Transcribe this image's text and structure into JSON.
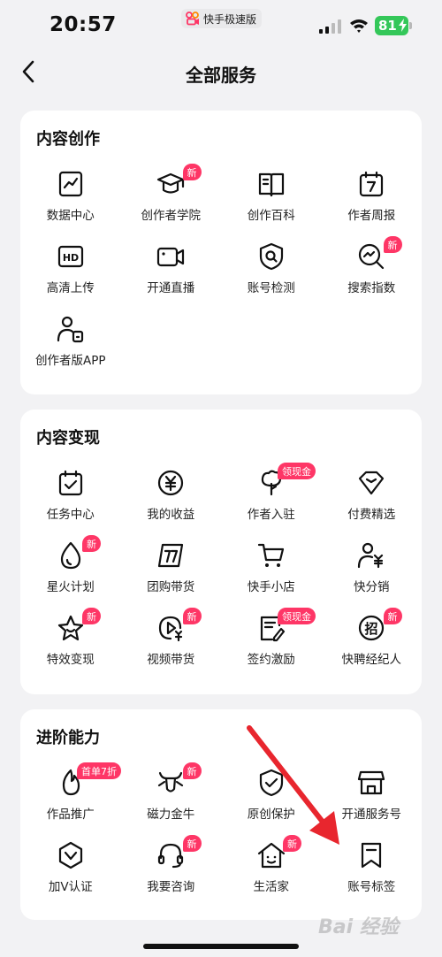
{
  "status_bar": {
    "time": "20:57",
    "app_label": "快手极速版",
    "battery": "81"
  },
  "nav": {
    "title": "全部服务"
  },
  "colors": {
    "accent": "#fe3666",
    "battery": "#34c759",
    "arrow": "#e8262e"
  },
  "sections": [
    {
      "title": "内容创作",
      "items": [
        {
          "label": "数据中心",
          "icon": "chart-icon",
          "badge": ""
        },
        {
          "label": "创作者学院",
          "icon": "graduation-cap-icon",
          "badge": "新"
        },
        {
          "label": "创作百科",
          "icon": "book-icon",
          "badge": ""
        },
        {
          "label": "作者周报",
          "icon": "calendar-7-icon",
          "badge": ""
        },
        {
          "label": "高清上传",
          "icon": "hd-icon",
          "badge": ""
        },
        {
          "label": "开通直播",
          "icon": "video-camera-icon",
          "badge": ""
        },
        {
          "label": "账号检测",
          "icon": "shield-search-icon",
          "badge": ""
        },
        {
          "label": "搜索指数",
          "icon": "search-trend-icon",
          "badge": "新"
        },
        {
          "label": "创作者版APP",
          "icon": "user-phone-icon",
          "badge": ""
        }
      ]
    },
    {
      "title": "内容变现",
      "items": [
        {
          "label": "任务中心",
          "icon": "calendar-check-icon",
          "badge": ""
        },
        {
          "label": "我的收益",
          "icon": "yen-circle-icon",
          "badge": ""
        },
        {
          "label": "作者入驻",
          "icon": "tree-icon",
          "badge": "领现金"
        },
        {
          "label": "付费精选",
          "icon": "diamond-icon",
          "badge": ""
        },
        {
          "label": "星火计划",
          "icon": "drop-icon",
          "badge": "新"
        },
        {
          "label": "团购带货",
          "icon": "coupon-icon",
          "badge": ""
        },
        {
          "label": "快手小店",
          "icon": "cart-icon",
          "badge": ""
        },
        {
          "label": "快分销",
          "icon": "user-yen-icon",
          "badge": ""
        },
        {
          "label": "特效变现",
          "icon": "star-icon",
          "badge": "新"
        },
        {
          "label": "视频带货",
          "icon": "play-yen-icon",
          "badge": "新"
        },
        {
          "label": "签约激励",
          "icon": "contract-icon",
          "badge": "领现金"
        },
        {
          "label": "快聘经纪人",
          "icon": "recruit-icon",
          "badge": "新"
        }
      ]
    },
    {
      "title": "进阶能力",
      "items": [
        {
          "label": "作品推广",
          "icon": "flame-icon",
          "badge": "首单7折"
        },
        {
          "label": "磁力金牛",
          "icon": "bull-icon",
          "badge": "新"
        },
        {
          "label": "原创保护",
          "icon": "shield-check-icon",
          "badge": ""
        },
        {
          "label": "开通服务号",
          "icon": "store-icon",
          "badge": ""
        },
        {
          "label": "加V认证",
          "icon": "v-badge-icon",
          "badge": ""
        },
        {
          "label": "我要咨询",
          "icon": "headset-icon",
          "badge": "新"
        },
        {
          "label": "生活家",
          "icon": "house-face-icon",
          "badge": "新"
        },
        {
          "label": "账号标签",
          "icon": "bookmark-icon",
          "badge": ""
        }
      ]
    }
  ],
  "watermark": "Bai 经验"
}
